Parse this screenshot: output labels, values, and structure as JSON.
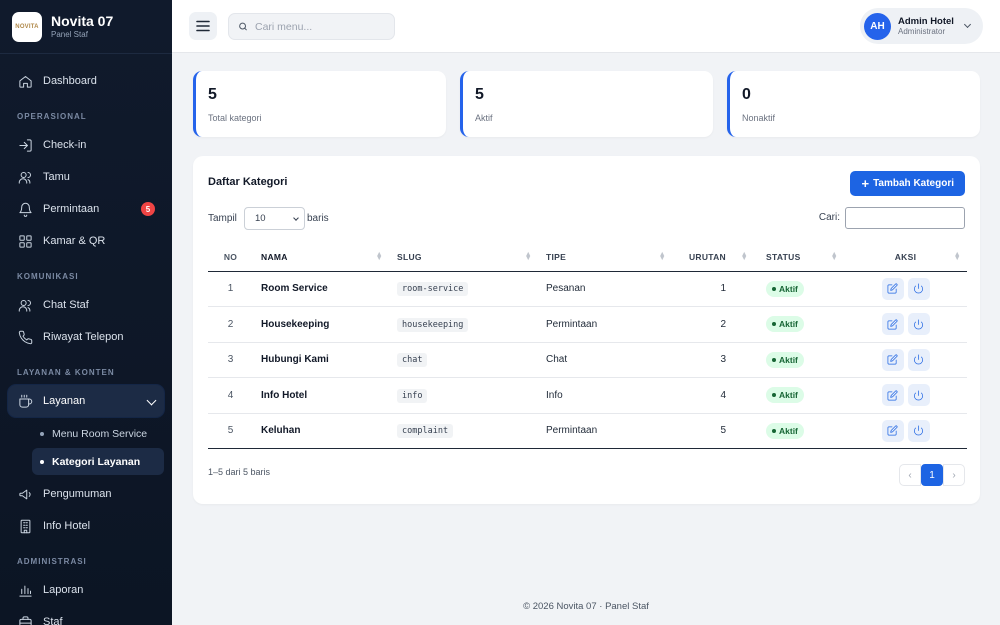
{
  "brand": {
    "logo_text": "NOVITA",
    "name": "Novita 07",
    "subtitle": "Panel Staf"
  },
  "search": {
    "placeholder": "Cari menu..."
  },
  "user": {
    "initials": "AH",
    "name": "Admin Hotel",
    "role": "Administrator"
  },
  "sidebar": {
    "dashboard": "Dashboard",
    "sections": {
      "operasional": "OPERASIONAL",
      "komunikasi": "KOMUNIKASI",
      "layanan_konten": "LAYANAN & KONTEN",
      "administrasi": "ADMINISTRASI"
    },
    "checkin": "Check-in",
    "tamu": "Tamu",
    "permintaan": "Permintaan",
    "permintaan_badge": "5",
    "kamar_qr": "Kamar & QR",
    "chat_staf": "Chat Staf",
    "riwayat_telepon": "Riwayat Telepon",
    "layanan": "Layanan",
    "menu_room_service": "Menu Room Service",
    "kategori_layanan": "Kategori Layanan",
    "pengumuman": "Pengumuman",
    "info_hotel": "Info Hotel",
    "laporan": "Laporan",
    "staf": "Staf"
  },
  "stats": [
    {
      "value": "5",
      "label": "Total kategori"
    },
    {
      "value": "5",
      "label": "Aktif"
    },
    {
      "value": "0",
      "label": "Nonaktif"
    }
  ],
  "card": {
    "title": "Daftar Kategori",
    "add_label": "Tambah Kategori",
    "show_label": "Tampil",
    "show_value": "10",
    "show_suffix": "baris",
    "search_label": "Cari:"
  },
  "table": {
    "headers": {
      "no": "NO",
      "nama": "NAMA",
      "slug": "SLUG",
      "tipe": "TIPE",
      "urutan": "URUTAN",
      "status": "STATUS",
      "aksi": "AKSI"
    },
    "rows": [
      {
        "no": "1",
        "nama": "Room Service",
        "slug": "room-service",
        "tipe": "Pesanan",
        "urutan": "1",
        "status": "Aktif"
      },
      {
        "no": "2",
        "nama": "Housekeeping",
        "slug": "housekeeping",
        "tipe": "Permintaan",
        "urutan": "2",
        "status": "Aktif"
      },
      {
        "no": "3",
        "nama": "Hubungi Kami",
        "slug": "chat",
        "tipe": "Chat",
        "urutan": "3",
        "status": "Aktif"
      },
      {
        "no": "4",
        "nama": "Info Hotel",
        "slug": "info",
        "tipe": "Info",
        "urutan": "4",
        "status": "Aktif"
      },
      {
        "no": "5",
        "nama": "Keluhan",
        "slug": "complaint",
        "tipe": "Permintaan",
        "urutan": "5",
        "status": "Aktif"
      }
    ]
  },
  "pagination": {
    "info": "1–5 dari 5 baris",
    "prev": "‹",
    "current": "1",
    "next": "›"
  },
  "footer": "© 2026 Novita 07 · Panel Staf",
  "colors": {
    "accent": "#1d64e3",
    "sidebar_bg": "#101a2c",
    "badge": "#ef4444",
    "status_bg": "#dcfce7",
    "status_text": "#166534"
  }
}
